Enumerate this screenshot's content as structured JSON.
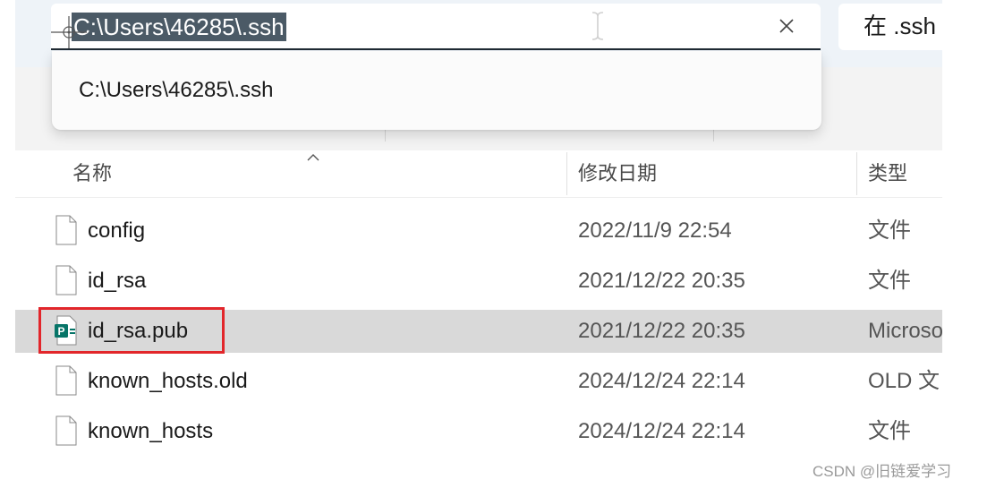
{
  "address_bar": {
    "value": "C:\\Users\\46285\\.ssh",
    "clear_icon": "close-icon"
  },
  "search": {
    "placeholder": "在 .ssh"
  },
  "suggestion": {
    "items": [
      "C:\\Users\\46285\\.ssh"
    ]
  },
  "columns": {
    "name": "名称",
    "modified": "修改日期",
    "type": "类型"
  },
  "files": [
    {
      "name": "config",
      "modified": "2022/11/9 22:54",
      "type": "文件",
      "icon": "generic-file-icon",
      "selected": false
    },
    {
      "name": "id_rsa",
      "modified": "2021/12/22 20:35",
      "type": "文件",
      "icon": "generic-file-icon",
      "selected": false
    },
    {
      "name": "id_rsa.pub",
      "modified": "2021/12/22 20:35",
      "type": "Microso",
      "icon": "publisher-file-icon",
      "selected": true
    },
    {
      "name": "known_hosts.old",
      "modified": "2024/12/24 22:14",
      "type": "OLD 文",
      "icon": "generic-file-icon",
      "selected": false
    },
    {
      "name": "known_hosts",
      "modified": "2024/12/24 22:14",
      "type": "文件",
      "icon": "generic-file-icon",
      "selected": false
    }
  ],
  "colors": {
    "selection": "#d9d9d9",
    "highlight_box": "#e2262b",
    "address_selection": "#4b5a66",
    "publisher_icon": "#077568"
  },
  "watermark": "CSDN @旧链爱学习"
}
